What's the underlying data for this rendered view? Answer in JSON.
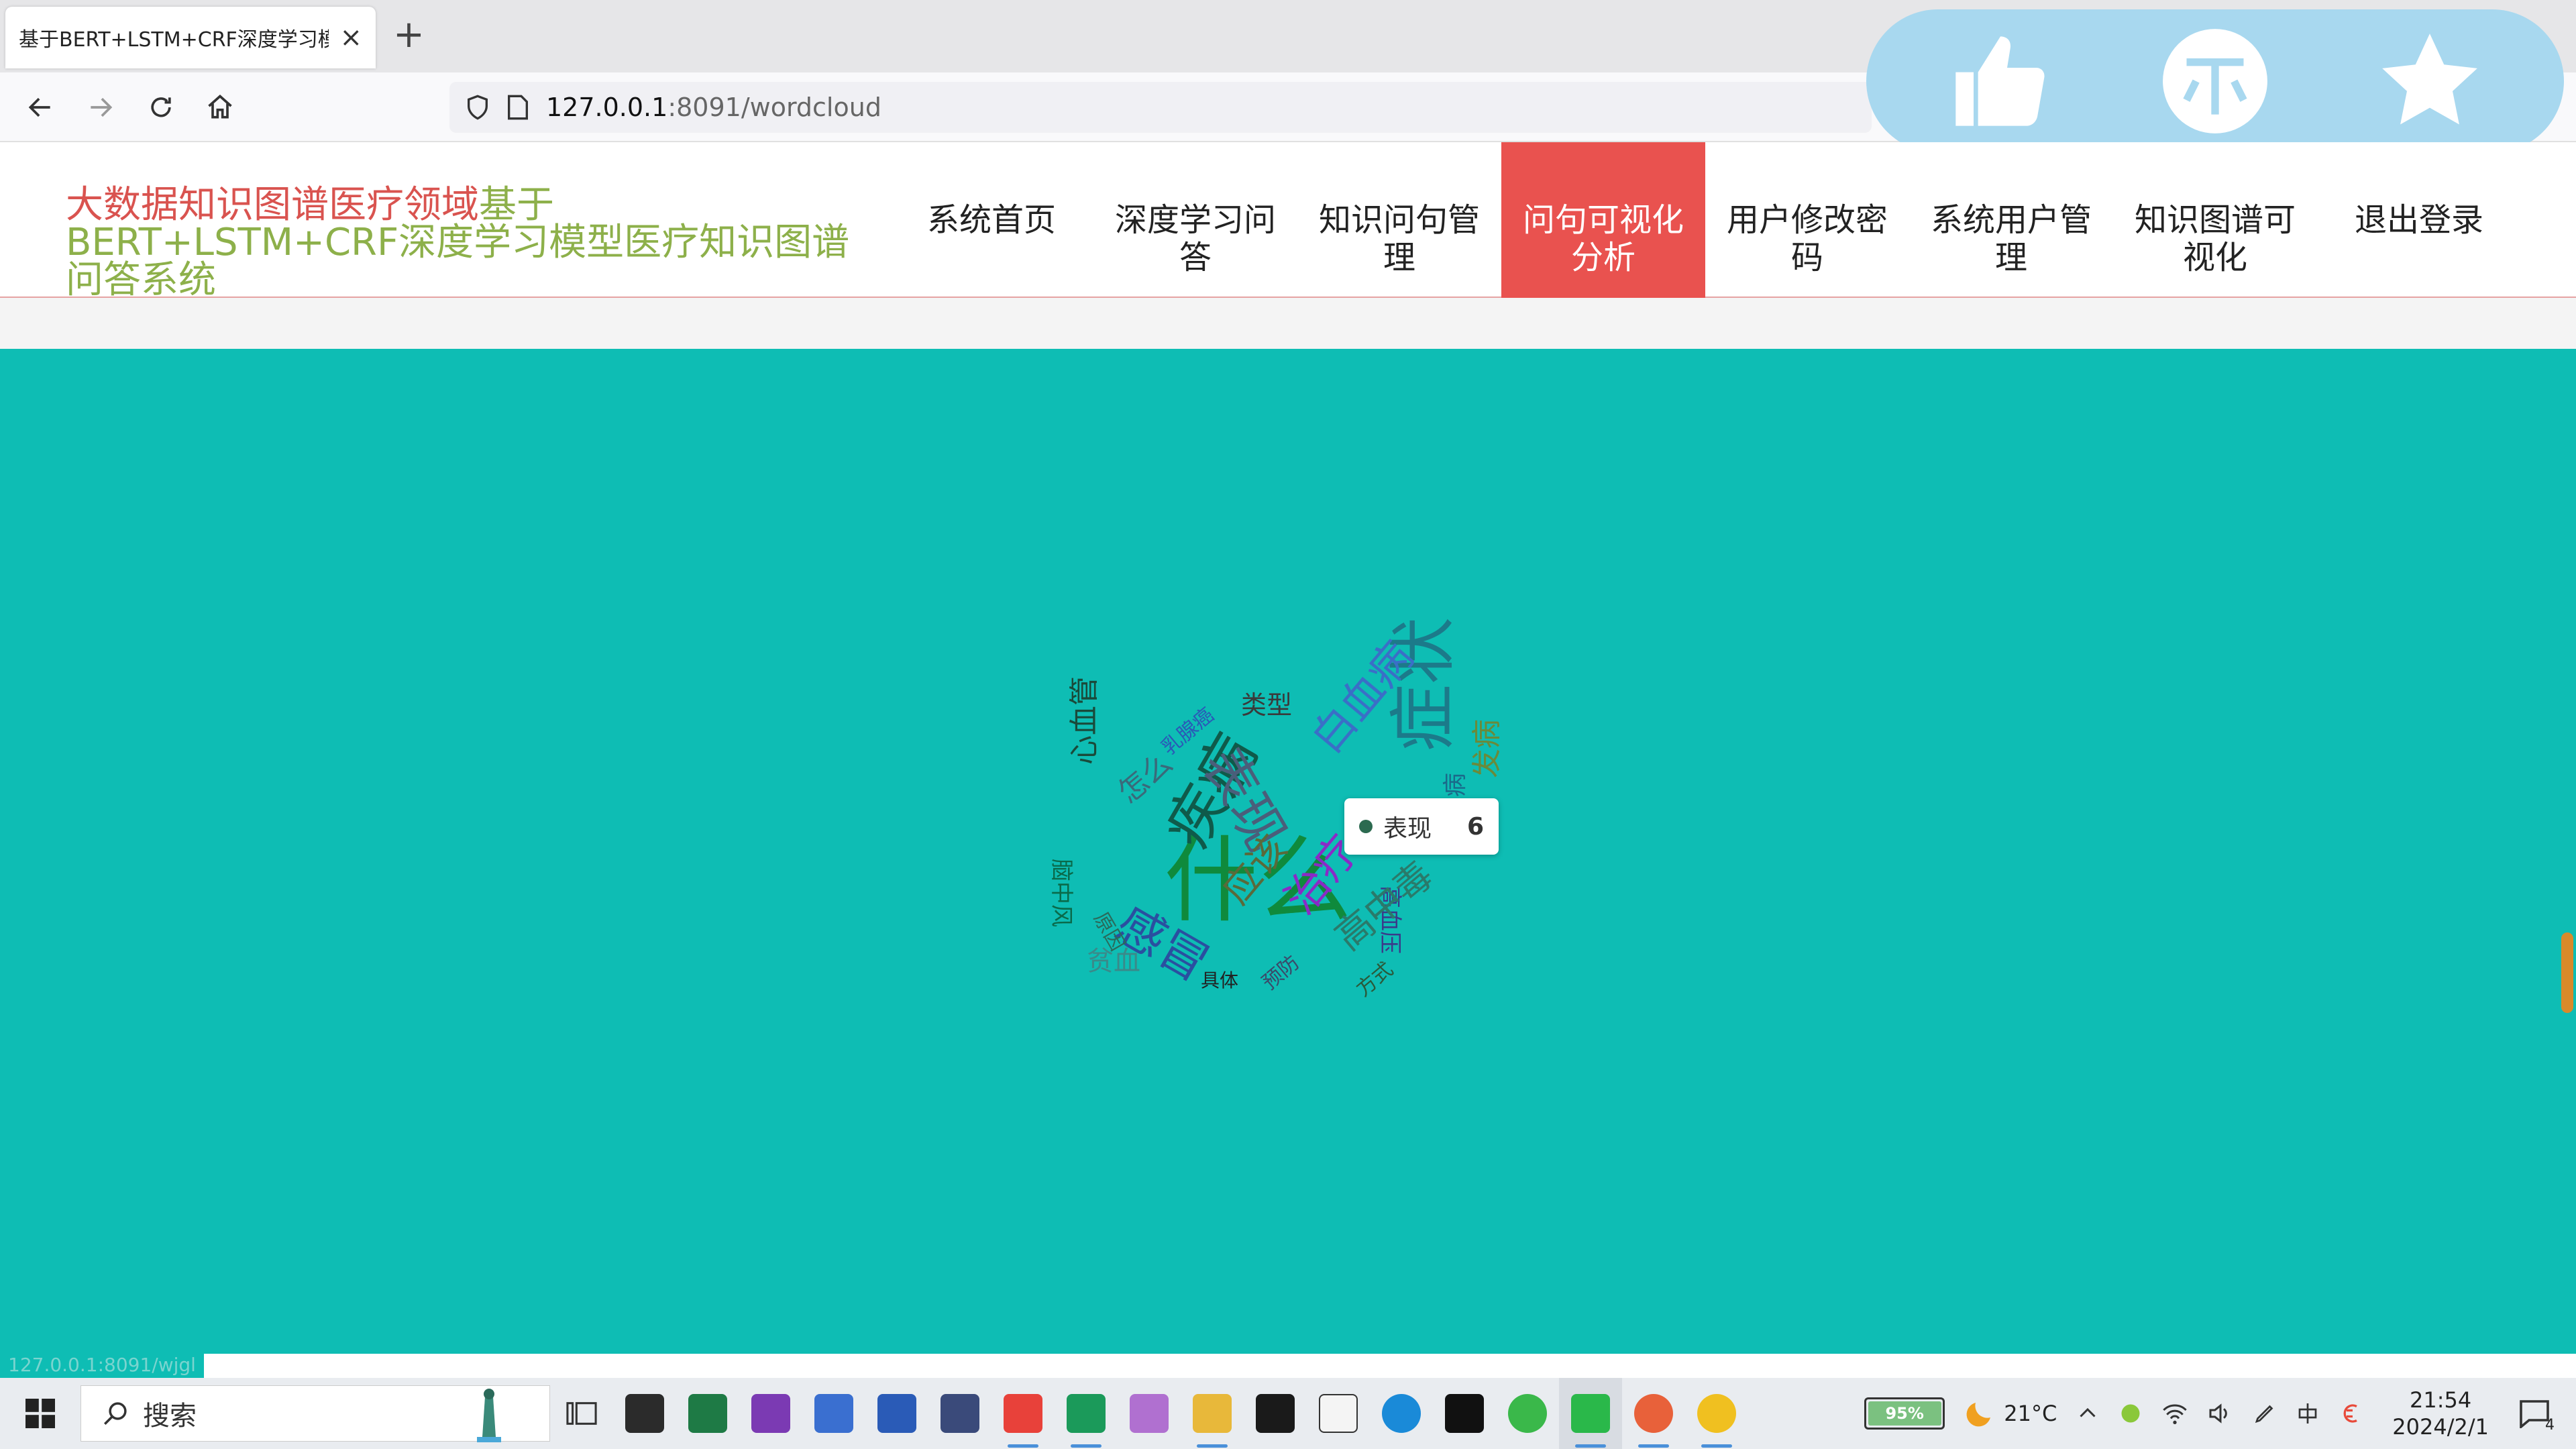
{
  "browser": {
    "tab_title": "基于BERT+LSTM+CRF深度学习模",
    "tab_close": "×",
    "new_tab": "+",
    "url_host": "127.0.0.1",
    "url_rest": ":8091/wordcloud"
  },
  "site": {
    "brand_part1": "大数据知识图谱医疗领域",
    "brand_part2": "基于BERT+LSTM+CRF深度学习模型医疗知识图谱问答系统",
    "nav": [
      {
        "label": "系统首页",
        "active": false
      },
      {
        "label": "深度学习问答",
        "active": false
      },
      {
        "label": "知识问句管理",
        "active": false
      },
      {
        "label": "问句可视化分析",
        "active": true
      },
      {
        "label": "用户修改密码",
        "active": false
      },
      {
        "label": "系统用户管理",
        "active": false
      },
      {
        "label": "知识图谱可视化",
        "active": false
      },
      {
        "label": "退出登录",
        "active": false
      }
    ]
  },
  "wordcloud": {
    "words": [
      {
        "text": "什么",
        "color": "#0f8a3c",
        "size": 140,
        "rotate": 0
      },
      {
        "text": "症状",
        "color": "#1c7a8a",
        "size": 100,
        "rotate": -90
      },
      {
        "text": "疾病",
        "color": "#0f5a4a",
        "size": 88,
        "rotate": -60
      },
      {
        "text": "表现",
        "color": "#4a5e7a",
        "size": 80,
        "rotate": 60
      },
      {
        "text": "白血病",
        "color": "#3a6fc7",
        "size": 64,
        "rotate": -50
      },
      {
        "text": "感冒",
        "color": "#2a4fa0",
        "size": 72,
        "rotate": 30
      },
      {
        "text": "治疗",
        "color": "#8a2ac7",
        "size": 64,
        "rotate": -50
      },
      {
        "text": "应该",
        "color": "#5a6a3a",
        "size": 56,
        "rotate": -50
      },
      {
        "text": "高血压",
        "color": "#3a3a8a",
        "size": 34,
        "rotate": 90
      },
      {
        "text": "贫血",
        "color": "#3a8a8a",
        "size": 40,
        "rotate": 0
      },
      {
        "text": "类型",
        "color": "#3a3a3a",
        "size": 38,
        "rotate": 0
      },
      {
        "text": "心血管",
        "color": "#1a4a3a",
        "size": 44,
        "rotate": -90
      },
      {
        "text": "高中毒",
        "color": "#2a7a6a",
        "size": 56,
        "rotate": -40
      },
      {
        "text": "怎么",
        "color": "#3a6a7a",
        "size": 44,
        "rotate": -40
      },
      {
        "text": "乳腺癌",
        "color": "#2a5ab7",
        "size": 30,
        "rotate": -40
      },
      {
        "text": "具体",
        "color": "#222222",
        "size": 28,
        "rotate": 0
      },
      {
        "text": "方式",
        "color": "#2a5a3a",
        "size": 30,
        "rotate": -40
      },
      {
        "text": "糖尿病",
        "color": "#1a6a8a",
        "size": 36,
        "rotate": -90
      },
      {
        "text": "脑中风",
        "color": "#0a6a4a",
        "size": 34,
        "rotate": 90
      },
      {
        "text": "预防",
        "color": "#3a4a6a",
        "size": 30,
        "rotate": -40
      },
      {
        "text": "发病",
        "color": "#6a8a3a",
        "size": 44,
        "rotate": -90
      },
      {
        "text": "原因",
        "color": "#2a6a5a",
        "size": 30,
        "rotate": 60
      }
    ]
  },
  "tooltip": {
    "label": "表现",
    "value": "6"
  },
  "status_url": "127.0.0.1:8091/wjgl",
  "taskbar": {
    "search_placeholder": "搜索",
    "weather": "21°C",
    "time": "21:54",
    "date": "2024/2/1",
    "battery": "95%",
    "notif_count": "4"
  },
  "colors": {
    "accent_red": "#e9524f",
    "main_bg": "#0ebdb4",
    "overlay_bg": "#a8d8ef"
  }
}
